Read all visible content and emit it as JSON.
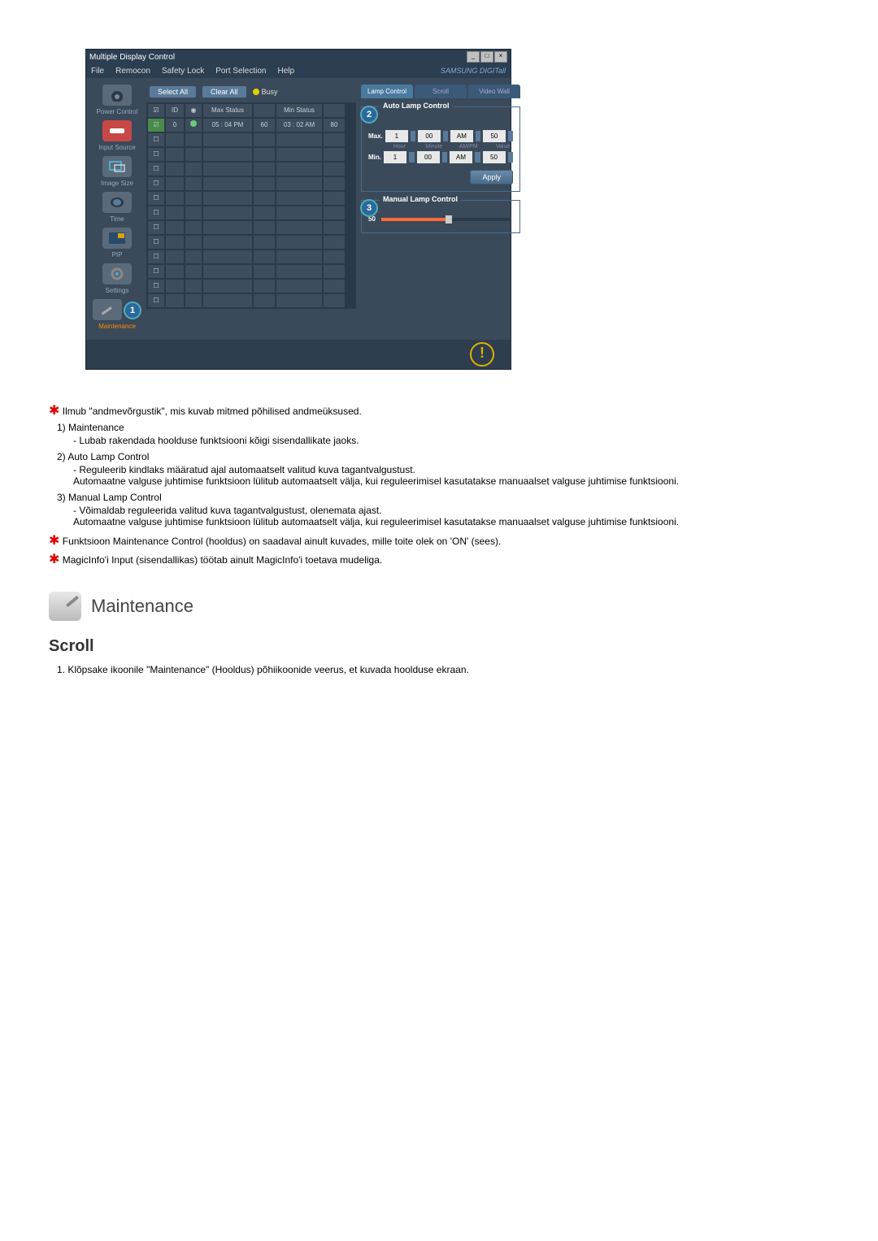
{
  "window": {
    "title": "Multiple Display Control",
    "brand": "SAMSUNG DIGITall"
  },
  "menu": {
    "file": "File",
    "remocon": "Remocon",
    "safety_lock": "Safety Lock",
    "port_selection": "Port Selection",
    "help": "Help"
  },
  "sidebar": {
    "power_control": "Power Control",
    "input_source": "Input Source",
    "image_size": "Image Size",
    "time": "Time",
    "pip": "PIP",
    "settings": "Settings",
    "maintenance": "Maintenance"
  },
  "callouts": {
    "c1": "1",
    "c2": "2",
    "c3": "3"
  },
  "toolbar": {
    "select_all": "Select All",
    "clear_all": "Clear All",
    "busy": "Busy"
  },
  "grid": {
    "headers": {
      "id": "ID",
      "max_status": "Max Status",
      "min_status": "Min Status"
    },
    "row": {
      "id": "0",
      "max_time": "05 : 04 PM",
      "max_val": "60",
      "min_time": "03 : 02 AM",
      "min_val": "80"
    }
  },
  "right": {
    "tabs": {
      "lamp": "Lamp Control",
      "scroll": "Scroll",
      "video_wall": "Video Wall"
    },
    "auto_lamp": {
      "title": "Auto Lamp Control",
      "max": "Max.",
      "min": "Min.",
      "hour": "Hour",
      "minute": "Minute",
      "ampm": "AM/PM",
      "value": "Value",
      "h_val": "1",
      "m_val": "00",
      "ap_val": "AM",
      "v_val": "50",
      "apply": "Apply"
    },
    "manual_lamp": {
      "title": "Manual Lamp Control",
      "value": "50"
    }
  },
  "doc": {
    "intro": "Ilmub \"andmevõrgustik\", mis kuvab mitmed põhilised andmeüksused.",
    "item1_title": "1)  Maintenance",
    "item1_desc": "- Lubab rakendada hoolduse funktsiooni kõigi sisendallikate jaoks.",
    "item2_title": "2)  Auto Lamp Control",
    "item2_desc": "- Reguleerib kindlaks määratud ajal automaatselt valitud kuva tagantvalgustust.\nAutomaatne valguse juhtimise funktsioon lülitub automaatselt välja, kui reguleerimisel kasutatakse manuaalset valguse juhtimise funktsiooni.",
    "item3_title": "3)  Manual Lamp Control",
    "item3_desc": "- Võimaldab reguleerida valitud kuva tagantvalgustust, olenemata ajast.\nAutomaatne valguse juhtimise funktsioon lülitub automaatselt välja, kui reguleerimisel kasutatakse manuaalset valguse juhtimise funktsiooni.",
    "note1": "Funktsioon Maintenance Control (hooldus) on saadaval ainult kuvades, mille toite olek on 'ON' (sees).",
    "note2": "MagicInfo'i Input (sisendallikas) töötab ainult MagicInfo'i toetava mudeliga.",
    "maint_heading": "Maintenance",
    "scroll_heading": "Scroll",
    "scroll_step1": "1.  Klõpsake ikoonile \"Maintenance\" (Hooldus) põhiikoonide veerus, et kuvada hoolduse ekraan."
  }
}
